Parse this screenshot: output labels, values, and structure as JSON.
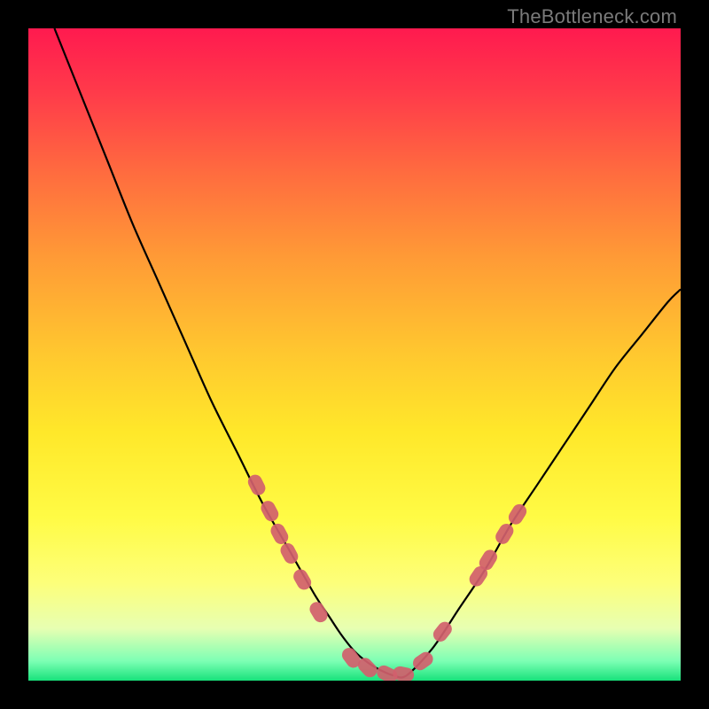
{
  "attribution": "TheBottleneck.com",
  "colors": {
    "page_bg": "#000000",
    "gradient_top": "#ff1a4f",
    "gradient_bottom": "#18e27b",
    "curve": "#000000",
    "markers": "#d1606c"
  },
  "chart_data": {
    "type": "line",
    "title": "",
    "xlabel": "",
    "ylabel": "",
    "xlim": [
      0,
      100
    ],
    "ylim": [
      0,
      100
    ],
    "grid": false,
    "series": [
      {
        "name": "curve",
        "x": [
          4,
          8,
          12,
          16,
          20,
          24,
          28,
          32,
          36,
          40,
          44,
          46,
          48,
          50,
          52,
          54,
          56,
          58,
          62,
          66,
          70,
          74,
          78,
          82,
          86,
          90,
          94,
          98,
          100
        ],
        "y": [
          100,
          90,
          80,
          70,
          61,
          52,
          43,
          35,
          27,
          20,
          13,
          10,
          7,
          4.5,
          2.8,
          1.6,
          0.8,
          0.8,
          5,
          11,
          17,
          24,
          30,
          36,
          42,
          48,
          53,
          58,
          60
        ]
      }
    ],
    "markers": {
      "type": "capsule",
      "points": [
        {
          "x": 35,
          "y": 30
        },
        {
          "x": 37,
          "y": 26
        },
        {
          "x": 38.5,
          "y": 22.5
        },
        {
          "x": 40,
          "y": 19.5
        },
        {
          "x": 42,
          "y": 15.5
        },
        {
          "x": 44.5,
          "y": 10.5
        },
        {
          "x": 49.5,
          "y": 3.5
        },
        {
          "x": 52,
          "y": 2
        },
        {
          "x": 55,
          "y": 1
        },
        {
          "x": 57.5,
          "y": 1
        },
        {
          "x": 60.5,
          "y": 3
        },
        {
          "x": 63.5,
          "y": 7.5
        },
        {
          "x": 69,
          "y": 16
        },
        {
          "x": 70.5,
          "y": 18.5
        },
        {
          "x": 73,
          "y": 22.5
        },
        {
          "x": 75,
          "y": 25.5
        }
      ]
    }
  }
}
